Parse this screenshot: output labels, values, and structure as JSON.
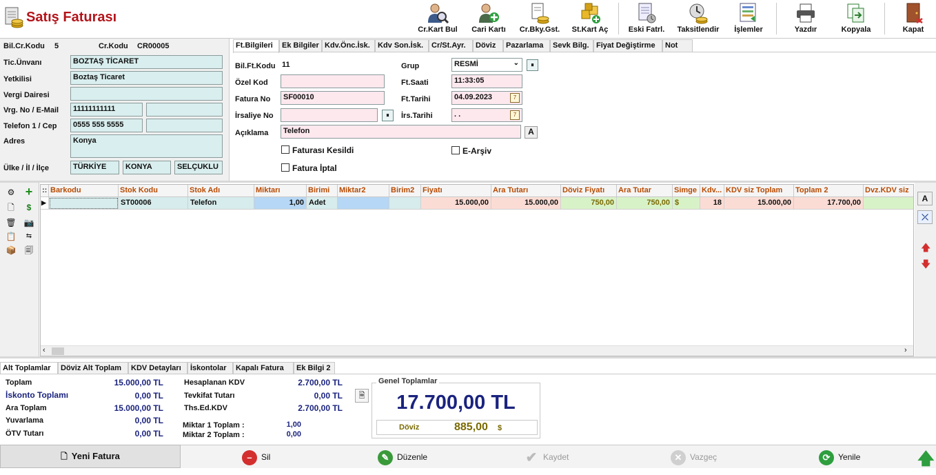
{
  "app": {
    "title": "Satış Faturası"
  },
  "toolbar": {
    "cr_kart_bul": "Cr.Kart Bul",
    "cari_karti": "Cari Kartı",
    "cr_bky_gst": "Cr.Bky.Gst.",
    "st_kart_ac": "St.Kart Aç",
    "eski_fatrl": "Eski Fatrl.",
    "taksitlendir": "Taksitlendir",
    "islemler": "İşlemler",
    "yazdir": "Yazdır",
    "kopyala": "Kopyala",
    "kapat": "Kapat"
  },
  "customer": {
    "bil_cr_kodu_label": "Bil.Cr.Kodu",
    "bil_cr_kodu": "5",
    "cr_kodu_label": "Cr.Kodu",
    "cr_kodu": "CR00005",
    "tic_unvani_label": "Tic.Ünvanı",
    "tic_unvani": "BOZTAŞ TİCARET",
    "yetkilisi_label": "Yetkilisi",
    "yetkilisi": "Boztaş Ticaret",
    "vergi_dairesi_label": "Vergi Dairesi",
    "vergi_dairesi": "",
    "vrg_no_label": "Vrg. No / E-Mail",
    "vrg_no": "11111111111",
    "email": "",
    "telefon_label": "Telefon 1 / Cep",
    "telefon": "0555 555 5555",
    "cep": "",
    "adres_label": "Adres",
    "adres": "Konya",
    "ulke_label": "Ülke / İl / İlçe",
    "ulke": "TÜRKİYE",
    "il": "KONYA",
    "ilce": "SELÇUKLU"
  },
  "tabs": [
    "Ft.Bilgileri",
    "Ek Bilgiler",
    "Kdv.Önc.İsk.",
    "Kdv Son.İsk.",
    "Cr/St.Ayr.",
    "Döviz",
    "Pazarlama",
    "Sevk Bilg.",
    "Fiyat Değiştirme",
    "Not"
  ],
  "invoice": {
    "bil_ft_kodu_label": "Bil.Ft.Kodu",
    "bil_ft_kodu": "11",
    "ozel_kod_label": "Özel Kod",
    "ozel_kod": "",
    "fatura_no_label": "Fatura No",
    "fatura_no": "SF00010",
    "irsaliye_no_label": "İrsaliye No",
    "irsaliye_no": "",
    "aciklama_label": "Açıklama",
    "aciklama": "Telefon",
    "grup_label": "Grup",
    "grup": "RESMİ",
    "ft_saati_label": "Ft.Saati",
    "ft_saati": "11:33:05",
    "ft_tarihi_label": "Ft.Tarihi",
    "ft_tarihi": "04.09.2023",
    "irs_tarihi_label": "İrs.Tarihi",
    "irs_tarihi": ". .",
    "faturasi_kesildi": "Faturası Kesildi",
    "fatura_iptal": "Fatura İptal",
    "e_arsiv": "E-Arşiv",
    "a_button": "A"
  },
  "grid": {
    "columns": [
      "Barkodu",
      "Stok Kodu",
      "Stok Adı",
      "Miktarı",
      "Birimi",
      "Miktar2",
      "Birim2",
      "Fiyatı",
      "Ara Tutarı",
      "Döviz Fiyatı",
      "Ara Tutar",
      "Simge",
      "Kdv...",
      "KDV siz Toplam",
      "Toplam 2",
      "Dvz.KDV siz"
    ],
    "rows": [
      {
        "barkodu": "",
        "stok_kodu": "ST00006",
        "stok_adi": "Telefon",
        "miktari": "1,00",
        "birimi": "Adet",
        "miktar2": "",
        "birim2": "",
        "fiyati": "15.000,00",
        "ara_tutari": "15.000,00",
        "doviz_fiyati": "750,00",
        "ara_tutar": "750,00",
        "simge": "$",
        "kdv": "18",
        "kdv_siz_toplam": "15.000,00",
        "toplam2": "17.700,00",
        "dvz_kdv_siz": ""
      }
    ]
  },
  "right_tools": {
    "a": "A"
  },
  "bottom_tabs": [
    "Alt Toplamlar",
    "Döviz Alt Toplam",
    "KDV Detayları",
    "İskontolar",
    "Kapalı Fatura",
    "Ek Bilgi 2"
  ],
  "totals": {
    "toplam_label": "Toplam",
    "toplam": "15.000,00 TL",
    "iskonto_label": "İskonto Toplamı",
    "iskonto": "0,00 TL",
    "ara_toplam_label": "Ara Toplam",
    "ara_toplam": "15.000,00 TL",
    "yuvarlama_label": "Yuvarlama",
    "yuvarlama": "0,00 TL",
    "otv_label": "ÖTV Tutarı",
    "otv": "0,00 TL",
    "hesaplanan_kdv_label": "Hesaplanan KDV",
    "hesaplanan_kdv": "2.700,00 TL",
    "tevkifat_label": "Tevkifat Tutarı",
    "tevkifat": "0,00 TL",
    "ths_ed_kdv_label": "Ths.Ed.KDV",
    "ths_ed_kdv": "2.700,00 TL",
    "miktar1_label": "Miktar 1 Toplam :",
    "miktar1": "1,00",
    "miktar2_label": "Miktar 2 Toplam :",
    "miktar2": "0,00",
    "genel_title": "Genel Toplamlar",
    "genel_toplam": "17.700,00 TL",
    "doviz_label": "Döviz",
    "doviz_value": "885,00",
    "doviz_symbol": "$"
  },
  "actions": {
    "yeni_fatura": "Yeni Fatura",
    "sil": "Sil",
    "duzenle": "Düzenle",
    "kaydet": "Kaydet",
    "vazgec": "Vazgeç",
    "yenile": "Yenile"
  }
}
